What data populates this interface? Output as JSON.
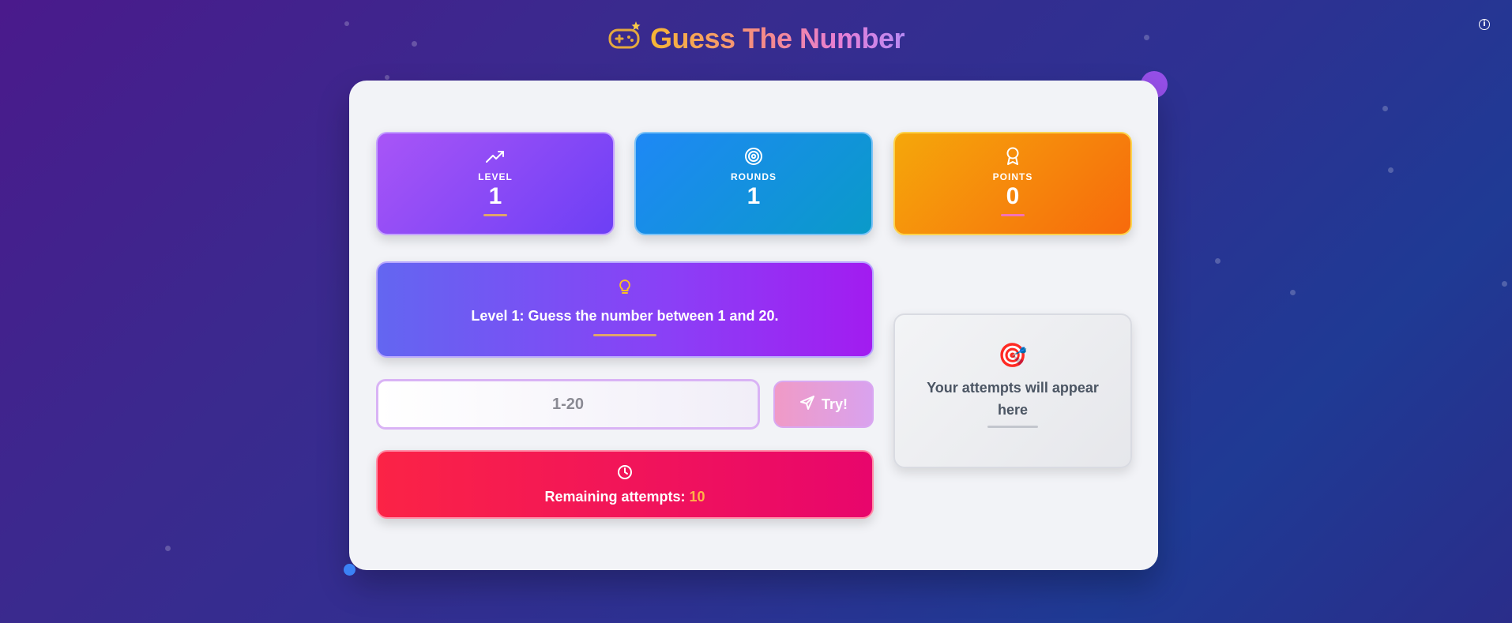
{
  "app": {
    "title": "Guess The Number",
    "info_icon": "info-icon",
    "logo_icon": "gamepad-icon"
  },
  "stats": {
    "level": {
      "label": "LEVEL",
      "value": "1",
      "icon": "trending-up-icon"
    },
    "rounds": {
      "label": "ROUNDS",
      "value": "1",
      "icon": "target-icon"
    },
    "points": {
      "label": "POINTS",
      "value": "0",
      "icon": "award-icon"
    }
  },
  "hint": {
    "text": "Level 1: Guess the number between 1 and 20.",
    "icon": "lightbulb-icon"
  },
  "guess": {
    "placeholder": "1-20",
    "value": ""
  },
  "try_button": {
    "label": "Try!",
    "icon": "send-icon"
  },
  "attempts": {
    "label": "Remaining attempts:",
    "value": "10",
    "icon": "clock-icon"
  },
  "history": {
    "text": "Your attempts will appear here",
    "icon": "dart-target-icon"
  },
  "colors": {
    "level": "#8b5cf6",
    "rounds": "#1e88f5",
    "points": "#f59e0b",
    "hint": "#7c3aed",
    "attempts": "#f43f5e",
    "attempts_number": "#ffb347"
  }
}
